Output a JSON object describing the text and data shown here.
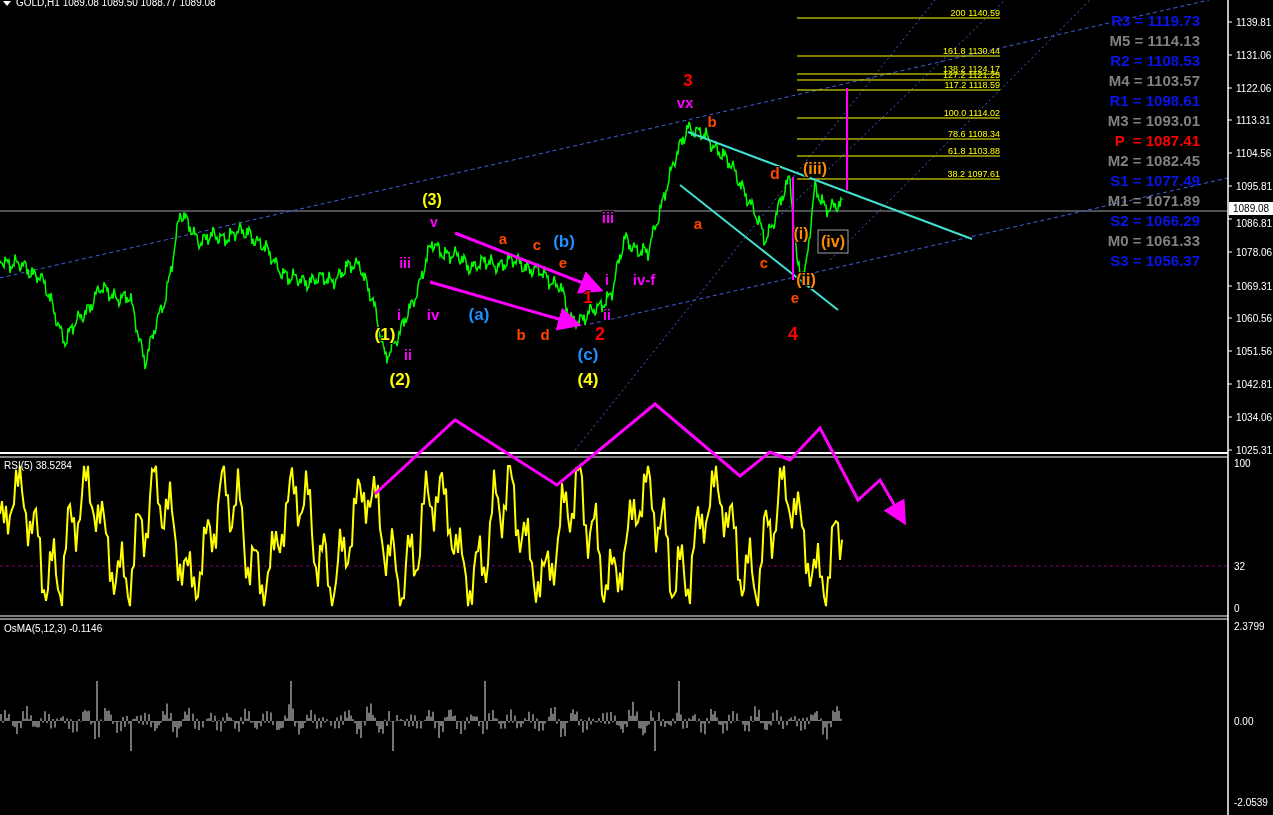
{
  "header": {
    "title": "GOLD,H1 1089.08 1089.50 1088.77 1089.08"
  },
  "price_axis": {
    "ticks": [
      "1139.81",
      "1131.06",
      "1122.06",
      "1113.31",
      "1104.56",
      "1095.81",
      "1086.81",
      "1078.06",
      "1069.31",
      "1060.56",
      "1051.56",
      "1042.81",
      "1034.06",
      "1025.31"
    ],
    "current_price": "1089.08"
  },
  "fibonacci_levels": [
    {
      "ratio": "200",
      "price": "1140.59"
    },
    {
      "ratio": "161.8",
      "price": "1130.44"
    },
    {
      "ratio": "138.2",
      "price": "1124.17"
    },
    {
      "ratio": "127.2",
      "price": "1121.25"
    },
    {
      "ratio": "117.2",
      "price": "1118.59"
    },
    {
      "ratio": "100.0",
      "price": "1114.02"
    },
    {
      "ratio": "78.6",
      "price": "1108.34"
    },
    {
      "ratio": "61.8",
      "price": "1103.88"
    },
    {
      "ratio": "38.2",
      "price": "1097.61"
    }
  ],
  "pivot_levels": [
    {
      "text": "R3 = 1119.73",
      "kind": "resistance"
    },
    {
      "text": "M5 = 1114.13",
      "kind": "mid"
    },
    {
      "text": "R2 = 1108.53",
      "kind": "resistance"
    },
    {
      "text": "M4 = 1103.57",
      "kind": "mid"
    },
    {
      "text": "R1 = 1098.61",
      "kind": "resistance"
    },
    {
      "text": "M3 = 1093.01",
      "kind": "mid"
    },
    {
      "text": "P  = 1087.41",
      "kind": "pivot"
    },
    {
      "text": "M2 = 1082.45",
      "kind": "mid"
    },
    {
      "text": "S1 = 1077.49",
      "kind": "support"
    },
    {
      "text": "M1 = 1071.89",
      "kind": "mid"
    },
    {
      "text": "S2 = 1066.29",
      "kind": "support"
    },
    {
      "text": "M0 = 1061.33",
      "kind": "mid"
    },
    {
      "text": "S3 = 1056.37",
      "kind": "support"
    }
  ],
  "wave_labels": [
    {
      "text": "3",
      "color": "#ff0000"
    },
    {
      "text": "vx",
      "color": "#ff00ff"
    },
    {
      "text": "b",
      "color": "#ff4500"
    },
    {
      "text": "(iii)",
      "color": "#ff8c00"
    },
    {
      "text": "d",
      "color": "#ff4500"
    },
    {
      "text": "(3)",
      "color": "#ffff00"
    },
    {
      "text": "iii",
      "color": "#ff00ff"
    },
    {
      "text": "v",
      "color": "#ff00ff"
    },
    {
      "text": "a",
      "color": "#ff4500"
    },
    {
      "text": "a",
      "color": "#ff4500"
    },
    {
      "text": "c",
      "color": "#ff4500"
    },
    {
      "text": "(b)",
      "color": "#1e90ff"
    },
    {
      "text": "(i)",
      "color": "#ff8c00"
    },
    {
      "text": "(iv)",
      "color": "#ff8c00"
    },
    {
      "text": "iii",
      "color": "#ff00ff"
    },
    {
      "text": "e",
      "color": "#ff4500"
    },
    {
      "text": "c",
      "color": "#ff4500"
    },
    {
      "text": "i",
      "color": "#ff00ff"
    },
    {
      "text": "iv-f",
      "color": "#ff00ff"
    },
    {
      "text": "(ii)",
      "color": "#ff8c00"
    },
    {
      "text": "1",
      "color": "#ff0000"
    },
    {
      "text": "e",
      "color": "#ff4500"
    },
    {
      "text": "i",
      "color": "#ff00ff"
    },
    {
      "text": "iv",
      "color": "#ff00ff"
    },
    {
      "text": "(a)",
      "color": "#1e90ff"
    },
    {
      "text": "ii",
      "color": "#ff00ff"
    },
    {
      "text": "(1)",
      "color": "#ffff00"
    },
    {
      "text": "b",
      "color": "#ff4500"
    },
    {
      "text": "d",
      "color": "#ff4500"
    },
    {
      "text": "2",
      "color": "#ff0000"
    },
    {
      "text": "4",
      "color": "#ff0000"
    },
    {
      "text": "ii",
      "color": "#ff00ff"
    },
    {
      "text": "(c)",
      "color": "#1e90ff"
    },
    {
      "text": "(2)",
      "color": "#ffff00"
    },
    {
      "text": "(4)",
      "color": "#ffff00"
    }
  ],
  "rsi_panel": {
    "label": "RSI(5) 38.5284",
    "ticks": [
      "100",
      "32",
      "0"
    ]
  },
  "osma_panel": {
    "label": "OsMA(5,12,3) -0.1146",
    "ticks": [
      "2.3799",
      "0.00",
      "-2.0539"
    ]
  }
}
